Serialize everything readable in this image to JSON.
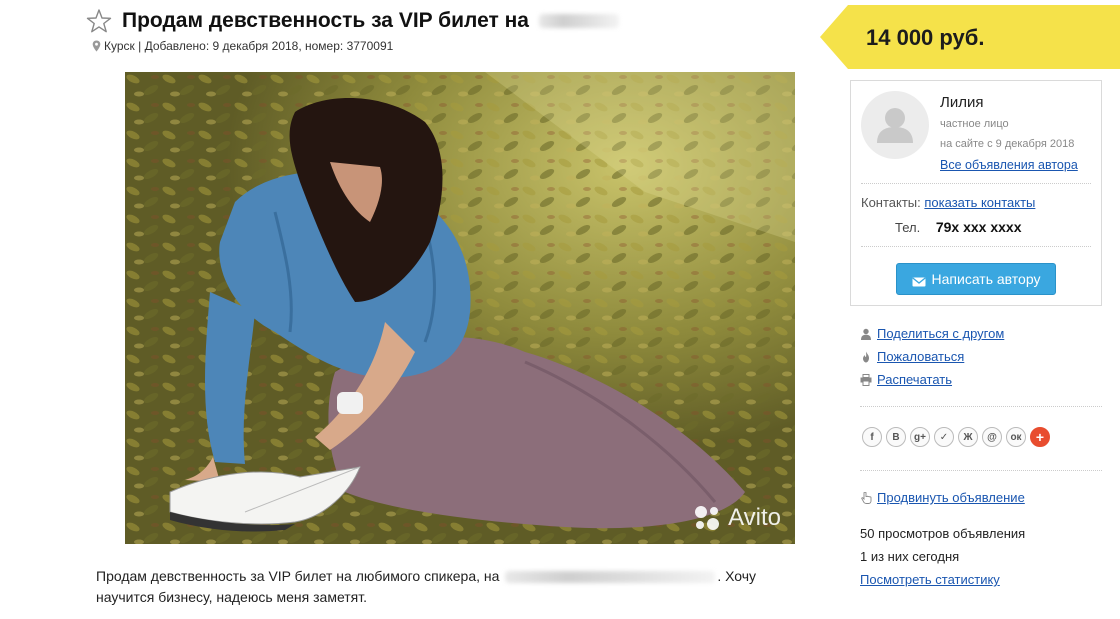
{
  "listing": {
    "title": "Продам девственность за VIP билет на",
    "location": "Курск",
    "meta": "| Добавлено: 9 декабря 2018, номер: 3770091",
    "description_start": "Продам девственность за VIP билет на любимого спикера, на",
    "description_end": ". Хочу научится бизнесу, надеюсь меня заметят.",
    "watermark": "Avito"
  },
  "price": {
    "value": "14 000 руб."
  },
  "seller": {
    "name": "Лилия",
    "type": "частное лицо",
    "since": "на сайте с 9 декабря 2018",
    "all_ads_link": "Все объявления автора",
    "contacts_label": "Контакты:",
    "contacts_link": "показать контакты",
    "phone_label": "Тел.",
    "phone_value": "79х ххх хххх",
    "write_button": "Написать автору"
  },
  "actions": {
    "share": "Поделиться с другом",
    "report": "Пожаловаться",
    "print": "Распечатать",
    "promote": "Продвинуть объявление"
  },
  "social": [
    {
      "label": "f",
      "icon": "facebook-icon"
    },
    {
      "label": "В",
      "icon": "vkontakte-icon"
    },
    {
      "label": "g+",
      "icon": "google-plus-icon"
    },
    {
      "label": "✓",
      "icon": "twitter-icon"
    },
    {
      "label": "Ж",
      "icon": "livejournal-icon"
    },
    {
      "label": "@",
      "icon": "mail-ru-icon"
    },
    {
      "label": "ок",
      "icon": "odnoklassniki-icon"
    },
    {
      "label": "+",
      "icon": "more-share-icon"
    }
  ],
  "stats": {
    "views_total": "50 просмотров объявления",
    "views_today": "1 из них сегодня",
    "stats_link": "Посмотреть статистику"
  },
  "colors": {
    "price_tag": "#f5e24a",
    "link": "#1a56b0",
    "button": "#3aa7e0"
  }
}
